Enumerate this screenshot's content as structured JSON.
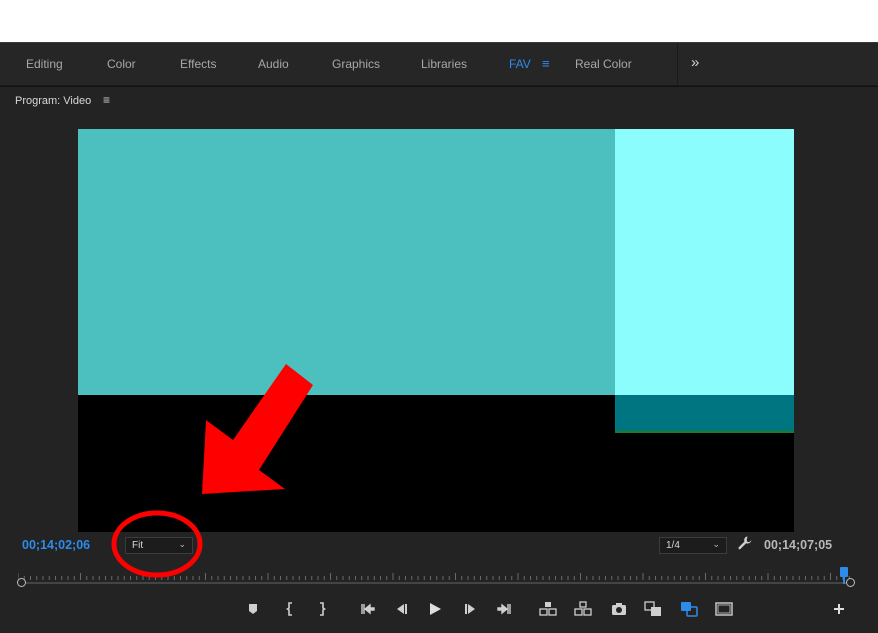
{
  "workspaces": {
    "tabs": [
      {
        "label": "Editing"
      },
      {
        "label": "Color"
      },
      {
        "label": "Effects"
      },
      {
        "label": "Audio"
      },
      {
        "label": "Graphics"
      },
      {
        "label": "Libraries"
      },
      {
        "label": "FAV"
      },
      {
        "label": "Real Color"
      }
    ],
    "active": "FAV",
    "menu_glyph": "≡",
    "overflow_glyph": "»"
  },
  "monitor": {
    "title": "Program: Video",
    "menu_glyph": "≡",
    "current_timecode": "00;14;02;06",
    "duration_timecode": "00;14;07;05",
    "zoom_level": "Fit",
    "resolution": "1/4",
    "playhead_fraction": 0.99
  },
  "controls": [
    {
      "name": "add-marker-icon"
    },
    {
      "name": "mark-in-icon"
    },
    {
      "name": "mark-out-icon"
    },
    {
      "name": "go-to-in-icon"
    },
    {
      "name": "step-back-icon"
    },
    {
      "name": "play-icon"
    },
    {
      "name": "step-forward-icon"
    },
    {
      "name": "go-to-out-icon"
    },
    {
      "name": "lift-icon"
    },
    {
      "name": "extract-icon"
    },
    {
      "name": "export-frame-icon"
    },
    {
      "name": "comparison-view-icon"
    },
    {
      "name": "proxy-toggle-icon"
    },
    {
      "name": "safe-margins-icon"
    },
    {
      "name": "button-editor-icon"
    }
  ],
  "colors": {
    "accent": "#2d8ceb",
    "annotation": "#ff0000",
    "panel_bg": "#232323"
  }
}
